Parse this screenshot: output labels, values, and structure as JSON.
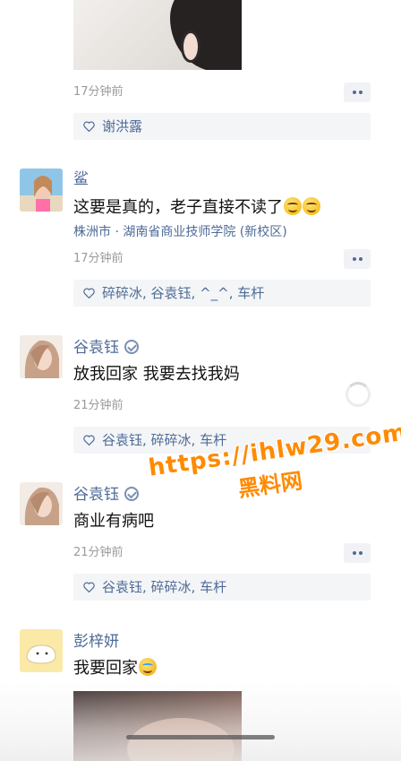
{
  "watermark": {
    "url": "https://ihlw29.com",
    "name": "黑料网"
  },
  "top_post": {
    "time": "17分钟前",
    "likes": "谢洪露"
  },
  "comments": [
    {
      "username": "鲨",
      "verified": false,
      "content": "这要是真的，老子直接不读了",
      "emoji": "smile-emoji x2",
      "location": "株洲市 · 湖南省商业技师学院 (新校区)",
      "time": "17分钟前",
      "likes": "碎碎冰, 谷袁钰, ^_^, 车杆"
    },
    {
      "username": "谷袁钰",
      "verified": true,
      "content": "放我回家 我要去找我妈",
      "time": "21分钟前",
      "likes": "谷袁钰, 碎碎冰, 车杆"
    },
    {
      "username": "谷袁钰",
      "verified": true,
      "content": "商业有病吧",
      "time": "21分钟前",
      "likes": "谷袁钰, 碎碎冰, 车杆"
    },
    {
      "username": "彭梓妍",
      "verified": false,
      "content": "我要回家",
      "emoji": "crying-emoji"
    }
  ],
  "colors": {
    "link": "#4e6b97",
    "muted": "#9a9a9a",
    "like_bg": "#f4f5f7",
    "watermark": "#ff8a00"
  }
}
